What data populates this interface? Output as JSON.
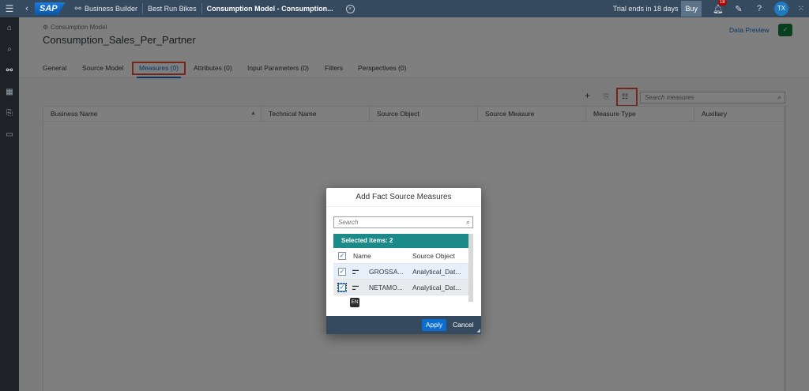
{
  "shell": {
    "logo": "SAP",
    "breadcrumbs": [
      "Business Builder",
      "Best Run Bikes",
      "Consumption Model - Consumption..."
    ],
    "trial_text": "Trial ends in 18 days",
    "buy_label": "Buy",
    "notification_count": "18",
    "avatar_initials": "TX"
  },
  "header": {
    "subtitle": "Consumption Model",
    "title": "Consumption_Sales_Per_Partner",
    "data_preview_label": "Data Preview"
  },
  "tabs": [
    "General",
    "Source Model",
    "Measures (0)",
    "Attributes (0)",
    "Input Parameters (0)",
    "Filters",
    "Perspectives (0)"
  ],
  "selected_tab": "Measures (0)",
  "toolbar": {
    "add_label": "+",
    "search_placeholder": "Search measures"
  },
  "table": {
    "columns": [
      "Business Name",
      "Technical Name",
      "Source Object",
      "Source Measure",
      "Measure Type",
      "Auxiliary"
    ]
  },
  "dialog": {
    "title": "Add Fact Source Measures",
    "search_placeholder": "Search",
    "selected_text": "Selected items: 2",
    "col_name": "Name",
    "col_source": "Source Object",
    "rows": [
      {
        "name": "GROSSA...",
        "source": "Analytical_Dat..."
      },
      {
        "name": "NETAMO...",
        "source": "Analytical_Dat..."
      }
    ],
    "tooltip": "EN",
    "apply_label": "Apply",
    "cancel_label": "Cancel"
  },
  "colors": {
    "shell": "#354a5f",
    "accent": "#0a6ed1",
    "highlight": "#e94c36",
    "selection_bar": "#1d8a8a"
  }
}
